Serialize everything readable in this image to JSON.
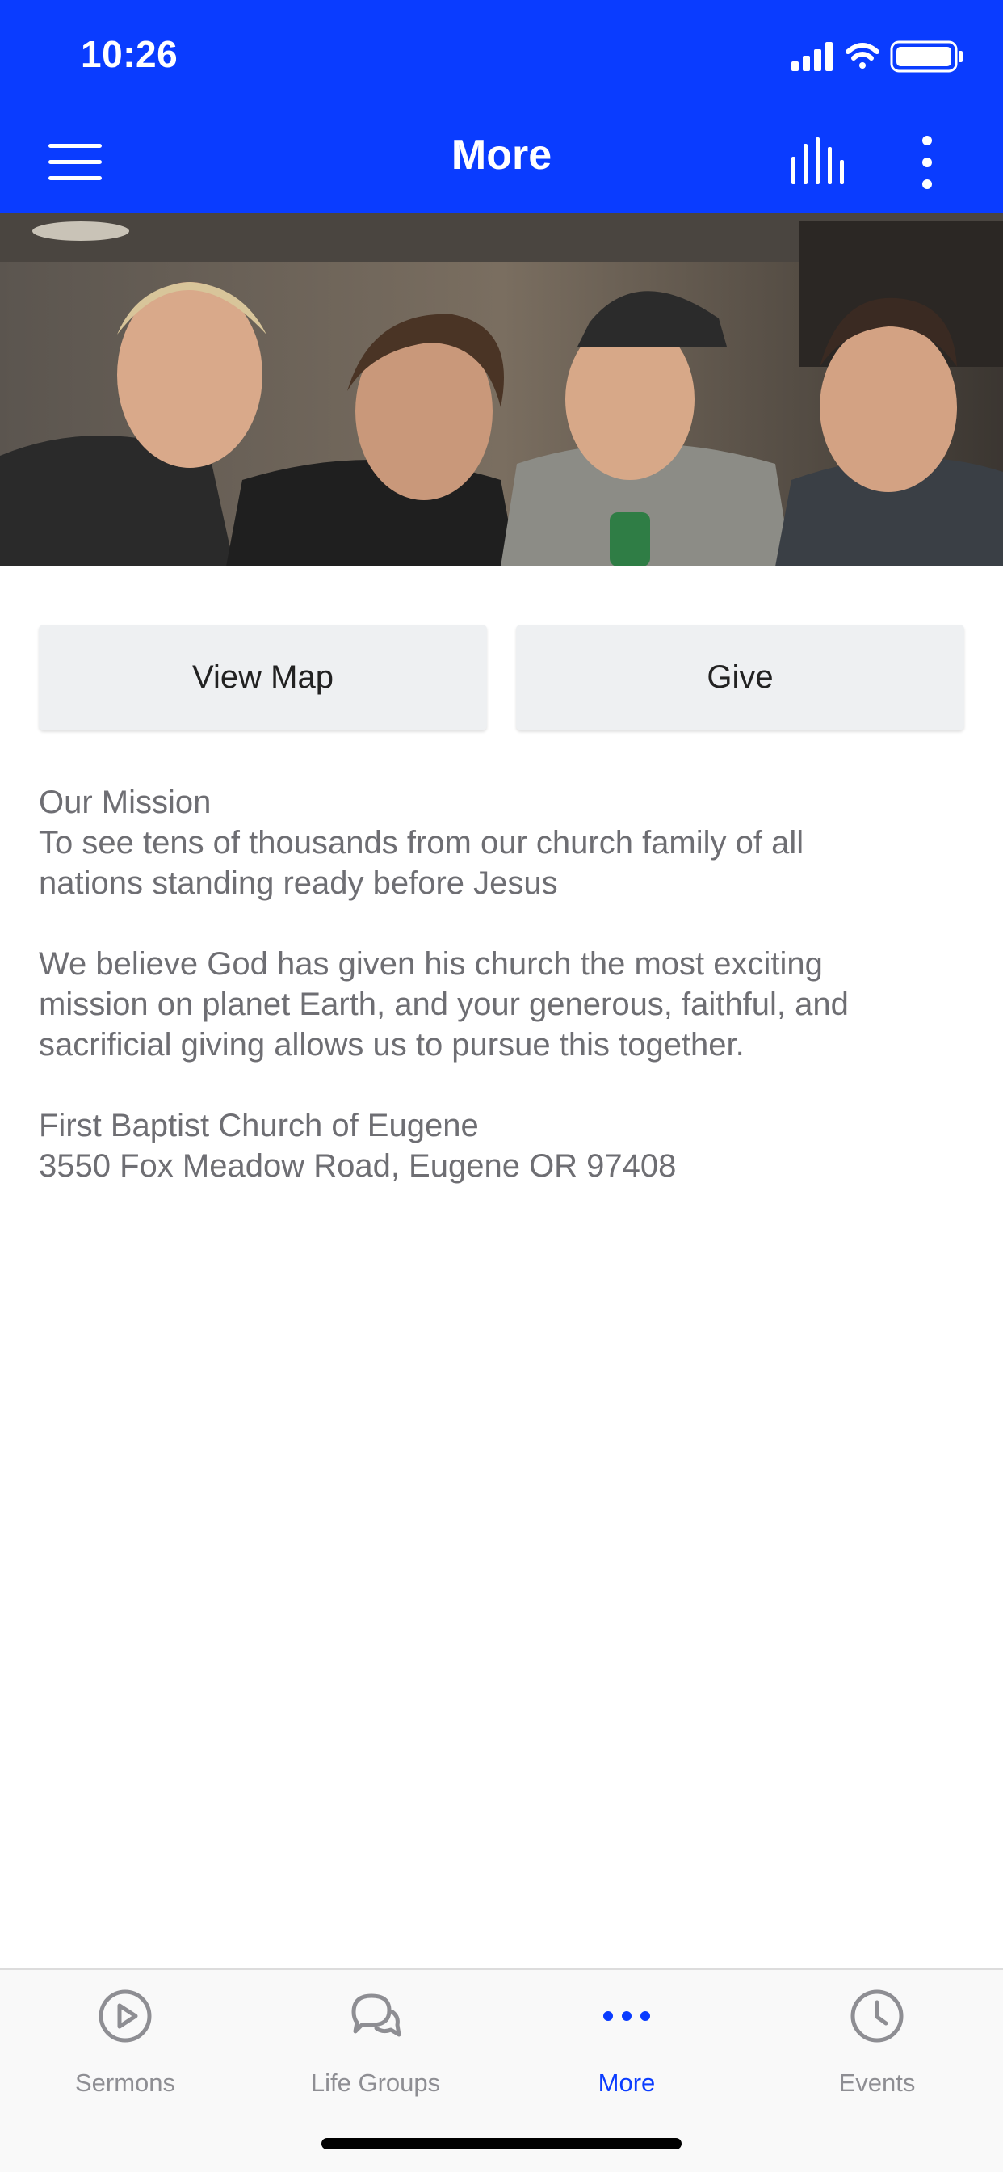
{
  "status_bar": {
    "time": "10:26",
    "icons": [
      "cellular-signal-icon",
      "wifi-icon",
      "battery-icon"
    ]
  },
  "nav": {
    "title": "More",
    "left_icon": "hamburger-menu-icon",
    "right_icons": [
      "audio-bars-icon",
      "vertical-ellipsis-icon"
    ]
  },
  "hero": {
    "description_icon": "hero-photo"
  },
  "buttons": {
    "view_map": "View Map",
    "give": "Give"
  },
  "content": {
    "mission_heading": "Our Mission",
    "mission_line1": "To see tens of thousands from our church family of all",
    "mission_line2": "nations standing ready before Jesus",
    "para_line1": "We believe God has given his church the most exciting",
    "para_line2": "mission on planet Earth, and your generous, faithful, and",
    "para_line3": "sacrificial giving allows us to pursue this together.",
    "church_name": "First Baptist Church of Eugene",
    "church_address": "3550 Fox Meadow Road, Eugene OR 97408"
  },
  "tabbar": {
    "tabs": [
      {
        "label": "Sermons",
        "icon": "play-circle-icon",
        "active": false
      },
      {
        "label": "Life Groups",
        "icon": "chat-bubbles-icon",
        "active": false
      },
      {
        "label": "More",
        "icon": "horizontal-ellipsis-icon",
        "active": true
      },
      {
        "label": "Events",
        "icon": "clock-icon",
        "active": false
      }
    ]
  },
  "colors": {
    "brand_blue": "#0a3cff",
    "inactive_gray": "#8e8e93",
    "body_text": "#6e6e73",
    "button_bg": "#eef0f2"
  }
}
